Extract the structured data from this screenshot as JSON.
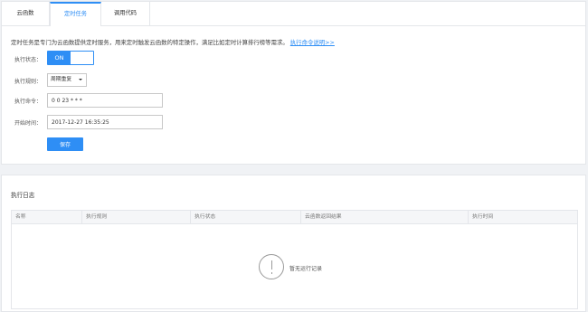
{
  "tabs": [
    {
      "label": "云函数"
    },
    {
      "label": "定时任务"
    },
    {
      "label": "调用代码"
    }
  ],
  "form": {
    "description": "定时任务是专门为云函数提供定时服务，用来定时触发云函数的特定操作，满足比如定时计算排行榜等需求。",
    "help_link": "执行命令说明>>",
    "status_label": "执行状态：",
    "toggle_on": "ON",
    "rule_label": "执行规则：",
    "rule_value": "周期重复",
    "command_label": "执行命令：",
    "command_value": "0 0 23 * * *",
    "start_label": "开始时间：",
    "start_value": "2017-12-27 16:35:25",
    "save_label": "保存"
  },
  "log": {
    "title": "执行日志",
    "columns": [
      "名称",
      "执行规则",
      "执行状态",
      "云函数返回结果",
      "执行时间"
    ],
    "empty_text": "暂无运行记录"
  },
  "colors": {
    "accent": "#2e8ef5",
    "background": "#f0f2f5"
  },
  "icons": {
    "empty": "exclamation-circle-icon",
    "dropdown": "caret-down-icon"
  }
}
